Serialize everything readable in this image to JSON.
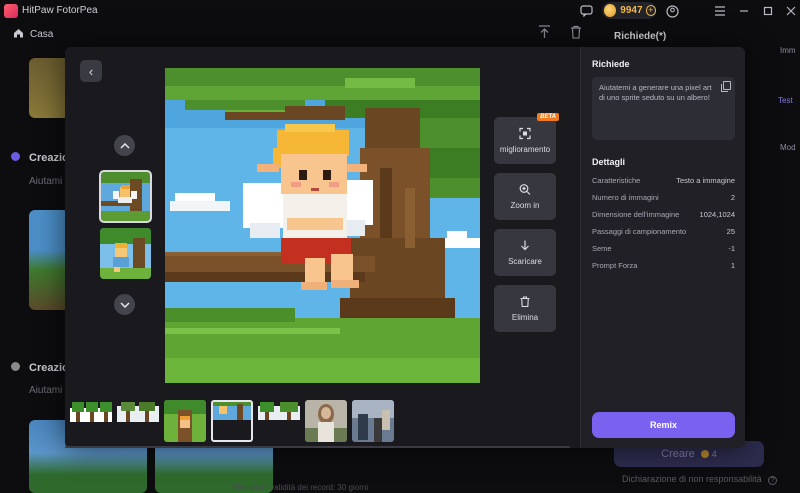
{
  "app": {
    "title": "HitPaw FotorPea"
  },
  "titlebar": {
    "coins": "9947",
    "plus": "+"
  },
  "navbar": {
    "home_label": "Casa"
  },
  "background": {
    "section1_title": "Creazio",
    "section1_sub": "Aiutami",
    "section2_title": "Creazio",
    "section2_sub": "Aiutami",
    "right_title": "Richiede(*)",
    "right_tab1": "Imm",
    "right_tab2": "Test",
    "right_tab3": "Mod",
    "create_label": "Creare",
    "create_cost": "4",
    "disclaimer": "Dichiarazione di non responsabilità",
    "validity": "Periodo di validità dei record: 30 giorni"
  },
  "viewer": {
    "back": "‹",
    "up": "︿",
    "down": "﹀"
  },
  "actions": [
    {
      "label": "miglioramento",
      "icon": "enhance-icon",
      "badge": "BETA"
    },
    {
      "label": "Zoom in",
      "icon": "zoom-in-icon"
    },
    {
      "label": "Scaricare",
      "icon": "download-icon"
    },
    {
      "label": "Elimina",
      "icon": "trash-icon"
    }
  ],
  "details_panel": {
    "prompt_title": "Richiede",
    "prompt_text": "Aiutatemi a generare una pixel art di uno sprite seduto su un albero!",
    "details_title": "Dettagli",
    "rows": [
      {
        "key": "Caratteristiche",
        "value": "Testo a immagine"
      },
      {
        "key": "Numero di immagini",
        "value": "2"
      },
      {
        "key": "Dimensione dell'immagine",
        "value": "1024,1024"
      },
      {
        "key": "Passaggi di campionamento",
        "value": "25"
      },
      {
        "key": "Seme",
        "value": "-1"
      },
      {
        "key": "Prompt Forza",
        "value": "1"
      }
    ],
    "remix_label": "Remix"
  },
  "colors": {
    "accent": "#7b61f0",
    "beta": "#f07a1f",
    "coin": "#f2b84b"
  }
}
